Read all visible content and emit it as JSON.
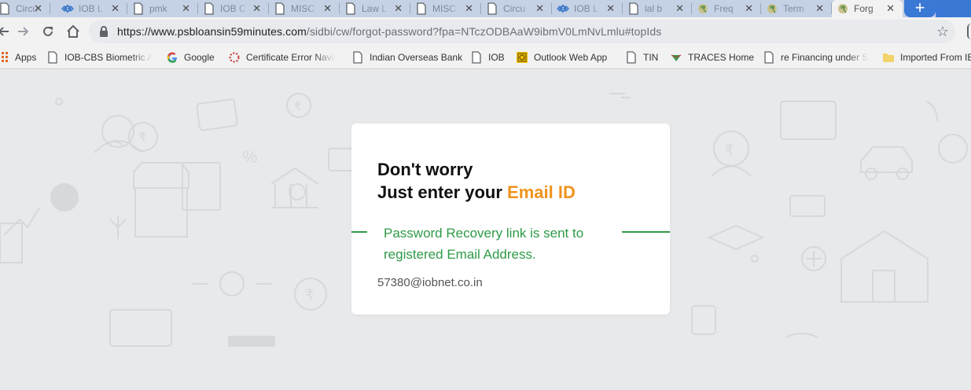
{
  "browser": {
    "tabs": [
      {
        "title": "Circu",
        "icon": "page-icon"
      },
      {
        "title": "IOB L",
        "icon": "diamond-logo-icon"
      },
      {
        "title": "pmk",
        "icon": "page-icon"
      },
      {
        "title": "IOB C",
        "icon": "page-icon"
      },
      {
        "title": "MISC",
        "icon": "page-icon"
      },
      {
        "title": "Law L",
        "icon": "page-icon"
      },
      {
        "title": "MISC",
        "icon": "page-icon"
      },
      {
        "title": "Circu",
        "icon": "page-icon"
      },
      {
        "title": "IOB L",
        "icon": "diamond-logo-icon"
      },
      {
        "title": "lal b",
        "icon": "page-icon"
      },
      {
        "title": "Freq",
        "icon": "rupee-coin-icon"
      },
      {
        "title": "Term",
        "icon": "rupee-coin-icon"
      },
      {
        "title": "Forg",
        "icon": "rupee-coin-icon",
        "active": true
      }
    ],
    "tab_close_glyph": "✕",
    "new_tab_glyph": "+",
    "url": {
      "host": "https://www.psbloansin59minutes.com",
      "path": "/sidbi/cw/forgot-password?fpa=NTczODBAaW9ibmV0LmNvLmlu#topIds"
    },
    "bookmarks": [
      {
        "label": "Apps",
        "icon": "apps-grid-icon"
      },
      {
        "label": "IOB-CBS Biometric Al",
        "icon": "page-icon"
      },
      {
        "label": "Google",
        "icon": "google-icon"
      },
      {
        "label": "Certificate Error Navig",
        "icon": "loading-icon"
      },
      {
        "label": "Indian Overseas Bank",
        "icon": "page-icon"
      },
      {
        "label": "IOB",
        "icon": "page-icon"
      },
      {
        "label": "Outlook Web App",
        "icon": "outlook-icon"
      },
      {
        "label": "TIN",
        "icon": "page-icon"
      },
      {
        "label": "TRACES Home",
        "icon": "traces-icon"
      },
      {
        "label": "re Financing under Sp",
        "icon": "page-icon"
      },
      {
        "label": "Imported From IE",
        "icon": "folder-icon"
      }
    ]
  },
  "page": {
    "heading_line1": "Don't worry",
    "heading_line2_prefix": "Just enter your ",
    "heading_line2_accent": "Email ID",
    "message": "Password Recovery link is sent to registered Email Address.",
    "email": "57380@iobnet.co.in"
  },
  "colors": {
    "accent_orange": "#f0931d",
    "success_green": "#2e9a47",
    "tab_strip": "#c5d2e6",
    "new_tab_blue": "#3a78d6"
  }
}
